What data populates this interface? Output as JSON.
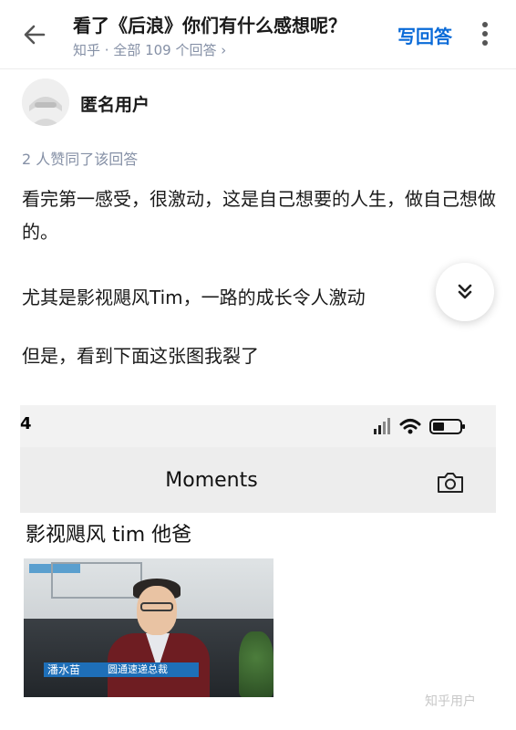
{
  "topbar": {
    "question_title": "看了《后浪》你们有什么感想呢？",
    "meta": "知乎 · 全部 109 个回答 ›",
    "write_answer_label": "写回答",
    "back_icon": "arrow-left-icon",
    "more_icon": "more-vertical-icon"
  },
  "author": {
    "name": "匿名用户",
    "avatar_icon": "anonymous-avatar-icon"
  },
  "answer": {
    "upvotes_text": "2 人赞同了该回答",
    "paragraphs": [
      "看完第一感受，很激动，这是自己想要的人生，做自己想做的。",
      "尤其是影视飓风Tim，一路的成长令人激动",
      "但是，看到下面这张图我裂了"
    ],
    "collapse_icon": "chevron-double-down-icon"
  },
  "embedded_screenshot": {
    "status_time": "4",
    "title": "Moments",
    "post_text": "影视飓风 tim 他爸",
    "caption_name": "潘水苗",
    "caption_role": "圆通速递总裁",
    "camera_icon": "camera-icon"
  },
  "watermark": "知乎用户",
  "colors": {
    "accent": "#0a6bd8",
    "meta_gray": "#8590a6",
    "text": "#1a1a1a"
  }
}
